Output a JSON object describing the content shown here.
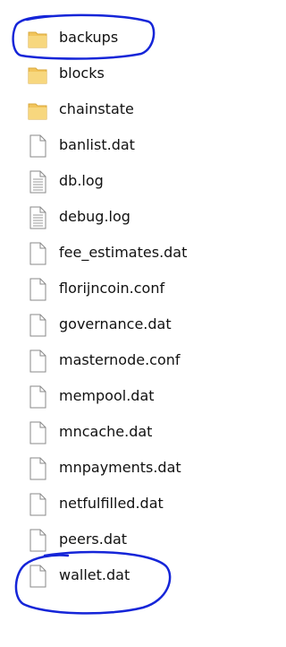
{
  "colors": {
    "folder": "#F2C55C",
    "folder_dark": "#D8A83C",
    "file_outline": "#8A8A8A",
    "file_fill": "#FFFFFF",
    "annotation": "#1525D8"
  },
  "items": [
    {
      "name": "backups",
      "type": "folder",
      "icon": "folder-icon",
      "circled": true
    },
    {
      "name": "blocks",
      "type": "folder",
      "icon": "folder-icon"
    },
    {
      "name": "chainstate",
      "type": "folder",
      "icon": "folder-icon"
    },
    {
      "name": "banlist.dat",
      "type": "file",
      "icon": "file-icon"
    },
    {
      "name": "db.log",
      "type": "text",
      "icon": "text-file-icon"
    },
    {
      "name": "debug.log",
      "type": "text",
      "icon": "text-file-icon"
    },
    {
      "name": "fee_estimates.dat",
      "type": "file",
      "icon": "file-icon"
    },
    {
      "name": "florijncoin.conf",
      "type": "file",
      "icon": "file-icon"
    },
    {
      "name": "governance.dat",
      "type": "file",
      "icon": "file-icon"
    },
    {
      "name": "masternode.conf",
      "type": "file",
      "icon": "file-icon"
    },
    {
      "name": "mempool.dat",
      "type": "file",
      "icon": "file-icon"
    },
    {
      "name": "mncache.dat",
      "type": "file",
      "icon": "file-icon"
    },
    {
      "name": "mnpayments.dat",
      "type": "file",
      "icon": "file-icon"
    },
    {
      "name": "netfulfilled.dat",
      "type": "file",
      "icon": "file-icon"
    },
    {
      "name": "peers.dat",
      "type": "file",
      "icon": "file-icon"
    },
    {
      "name": "wallet.dat",
      "type": "file",
      "icon": "file-icon",
      "circled": true
    }
  ]
}
